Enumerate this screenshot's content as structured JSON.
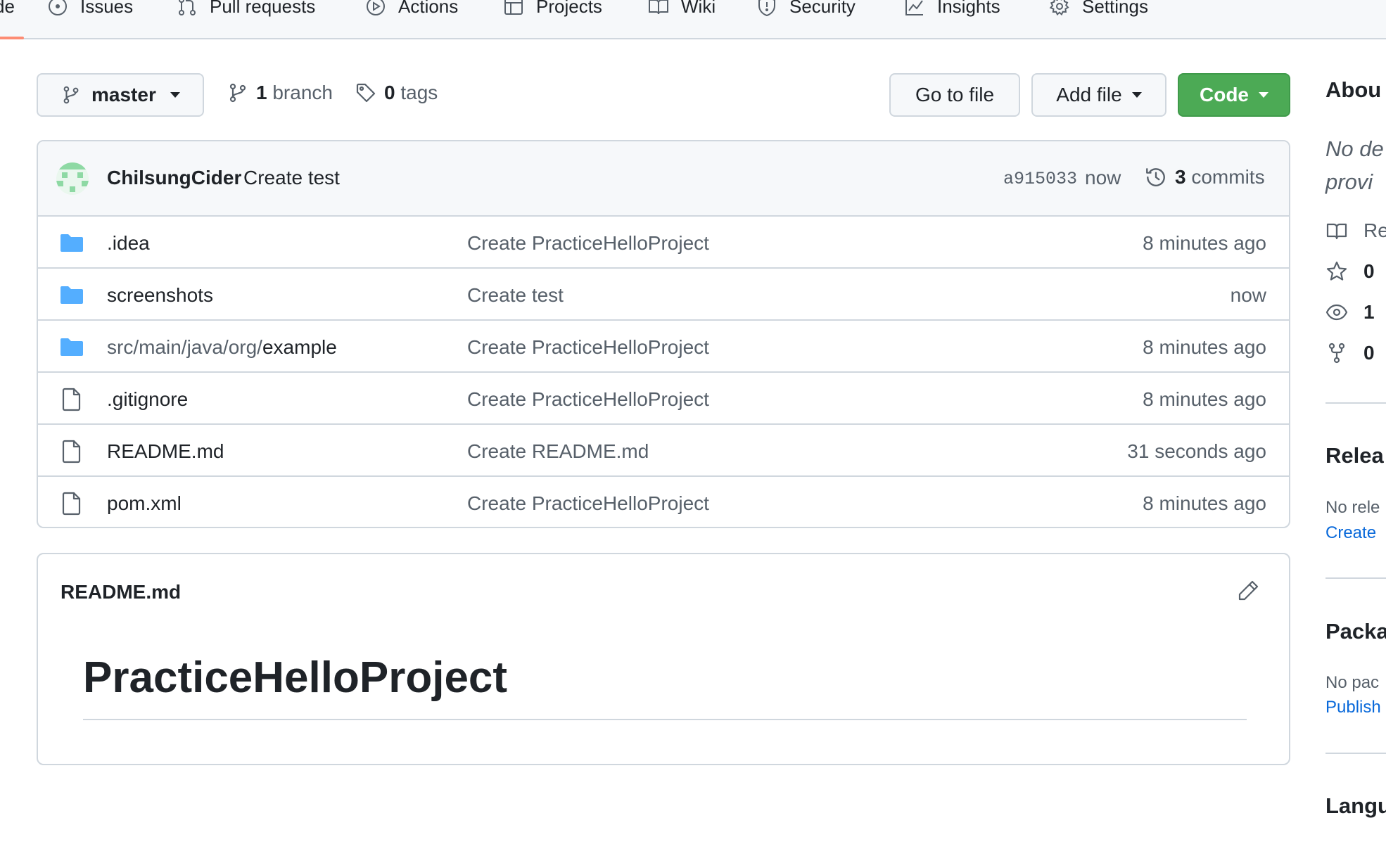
{
  "nav": {
    "tabs": [
      {
        "label": "de",
        "icon": "code-icon"
      },
      {
        "label": "Issues",
        "icon": "issue-icon"
      },
      {
        "label": "Pull requests",
        "icon": "pull-request-icon"
      },
      {
        "label": "Actions",
        "icon": "play-icon"
      },
      {
        "label": "Projects",
        "icon": "table-icon"
      },
      {
        "label": "Wiki",
        "icon": "book-icon"
      },
      {
        "label": "Security",
        "icon": "shield-icon"
      },
      {
        "label": "Insights",
        "icon": "graph-icon"
      },
      {
        "label": "Settings",
        "icon": "gear-icon"
      }
    ],
    "active_tab": "de",
    "accent_color": "#fd8c73"
  },
  "repo_bar": {
    "branch": "master",
    "branch_count": "1",
    "branch_word": "branch",
    "tag_count": "0",
    "tag_word": "tags",
    "go_to_file": "Go to file",
    "add_file": "Add file",
    "code": "Code",
    "code_color": "#4caa55"
  },
  "latest_commit": {
    "author": "ChilsungCider",
    "message": "Create test",
    "sha": "a915033",
    "time": "now",
    "commit_count": "3",
    "commit_word": "commits"
  },
  "files": [
    {
      "type": "folder",
      "name": "",
      "name_path": "",
      "name_display": ".idea",
      "message": "Create PracticeHelloProject",
      "time": "8 minutes ago"
    },
    {
      "type": "folder",
      "name_path": "",
      "name_display": "screenshots",
      "message": "Create test",
      "time": "now"
    },
    {
      "type": "folder",
      "name_path": "src/main/java/org/",
      "name_display": "example",
      "message": "Create PracticeHelloProject",
      "time": "8 minutes ago"
    },
    {
      "type": "file",
      "name_path": "",
      "name_display": ".gitignore",
      "message": "Create PracticeHelloProject",
      "time": "8 minutes ago"
    },
    {
      "type": "file",
      "name_path": "",
      "name_display": "README.md",
      "message": "Create README.md",
      "time": "31 seconds ago"
    },
    {
      "type": "file",
      "name_path": "",
      "name_display": "pom.xml",
      "message": "Create PracticeHelloProject",
      "time": "8 minutes ago"
    }
  ],
  "readme": {
    "filename": "README.md",
    "heading": "PracticeHelloProject"
  },
  "sidebar": {
    "about_heading": "Abou",
    "description_line1": "No de",
    "description_line2": "provi",
    "stats": [
      {
        "icon": "book-icon",
        "label": "Re"
      },
      {
        "icon": "star-icon",
        "label": "0"
      },
      {
        "icon": "eye-icon",
        "label": "1"
      },
      {
        "icon": "fork-icon",
        "label": "0"
      }
    ],
    "releases_heading": "Relea",
    "releases_note": "No rele",
    "releases_link": "Create",
    "packages_heading": "Packa",
    "packages_note": "No pac",
    "packages_link": "Publish",
    "languages_heading": "Langu"
  }
}
